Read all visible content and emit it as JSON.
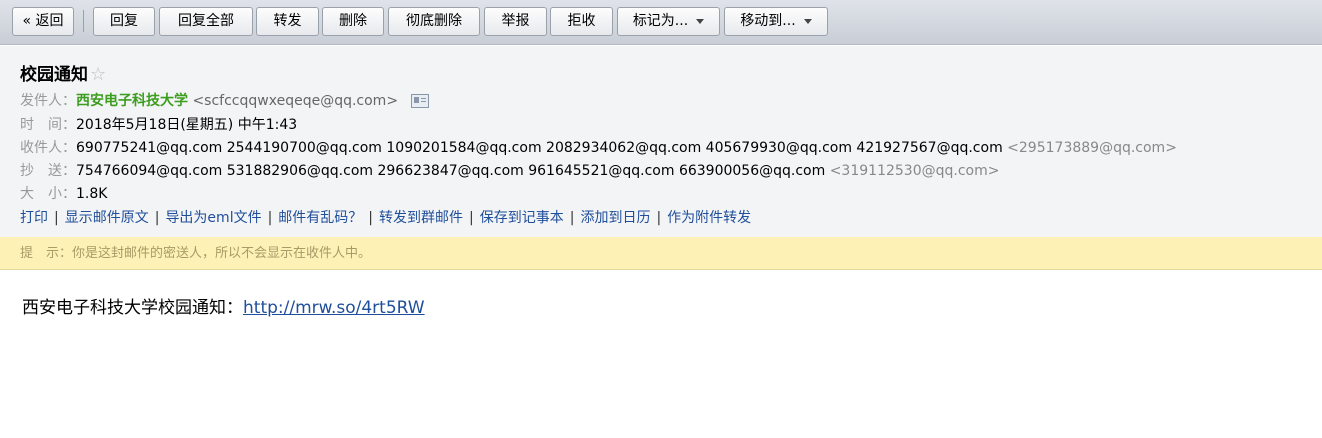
{
  "toolbar": {
    "back": "« 返回",
    "reply": "回复",
    "reply_all": "回复全部",
    "forward": "转发",
    "delete": "删除",
    "delete_permanently": "彻底删除",
    "report": "举报",
    "reject": "拒收",
    "mark_as": "标记为...",
    "move_to": "移动到..."
  },
  "email": {
    "subject": "校园通知",
    "star": "☆",
    "sender_label": "发件人：",
    "sender_name": "西安电子科技大学",
    "sender_email": "<scfccqqwxeqeqe@qq.com>",
    "time_label": "时　间：",
    "time": "2018年5月18日(星期五) 中午1:43",
    "to_label": "收件人：",
    "to": "690775241@qq.com 2544190700@qq.com 1090201584@qq.com 2082934062@qq.com 405679930@qq.com 421927567@qq.com",
    "to_extra": "<295173889@qq.com>",
    "cc_label": "抄　送：",
    "cc": "754766094@qq.com 531882906@qq.com 296623847@qq.com 961645521@qq.com 663900056@qq.com",
    "cc_extra": "<319112530@qq.com>",
    "size_label": "大　小：",
    "size": "1.8K"
  },
  "actions": {
    "print": "打印",
    "show_source": "显示邮件原文",
    "export_eml": "导出为eml文件",
    "garbled": "邮件有乱码？",
    "forward_group": "转发到群邮件",
    "save_notes": "保存到记事本",
    "add_calendar": "添加到日历",
    "forward_attachment": "作为附件转发",
    "separator": "|"
  },
  "tip": {
    "label": "提　示：",
    "text": "你是这封邮件的密送人，所以不会显示在收件人中。"
  },
  "body": {
    "text": "西安电子科技大学校园通知：",
    "link": "http://mrw.so/4rt5RW"
  }
}
